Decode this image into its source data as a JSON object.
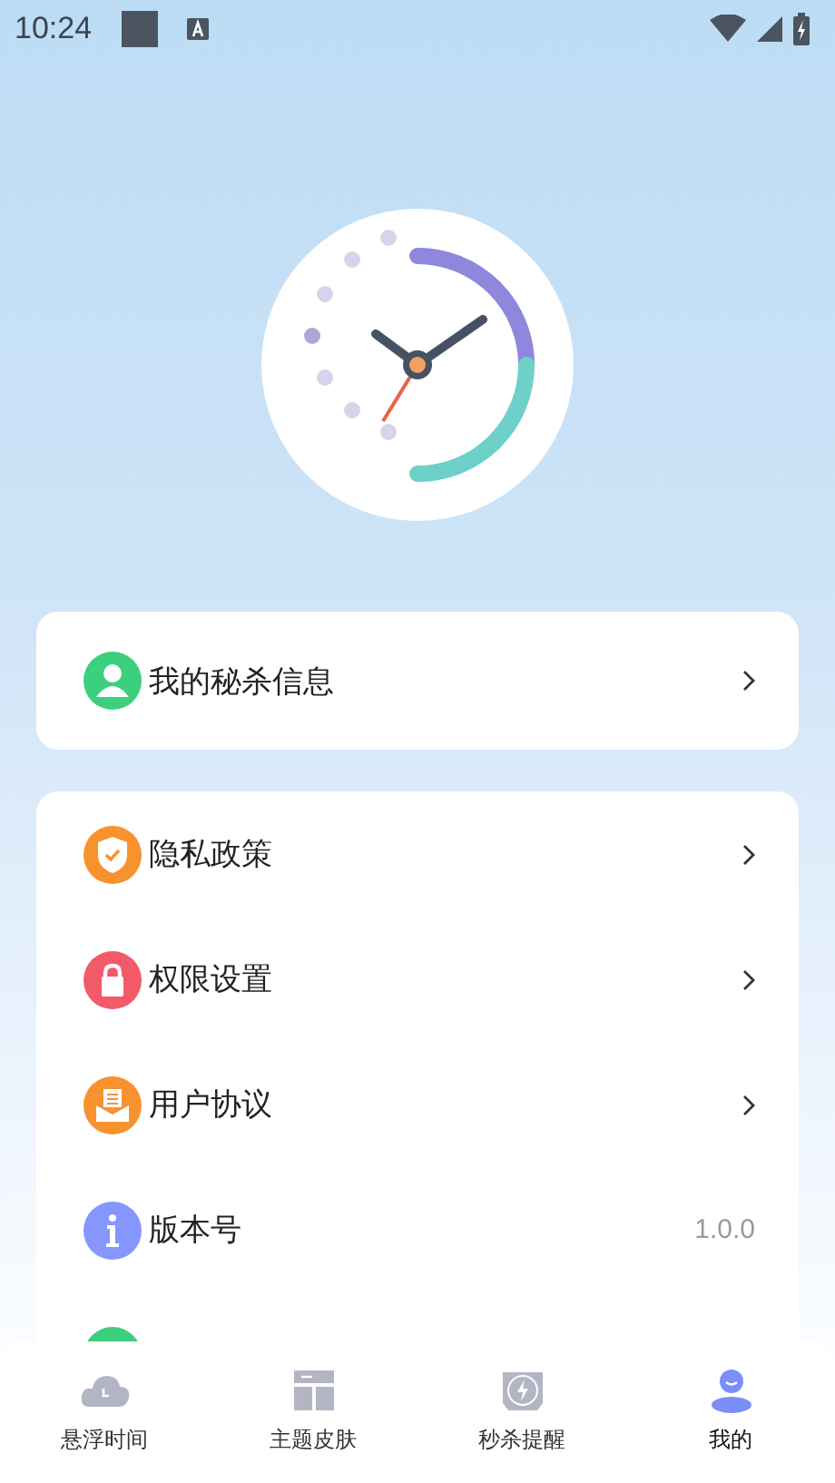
{
  "status_bar": {
    "time": "10:24"
  },
  "menu_groups": [
    {
      "items": [
        {
          "kind": "link",
          "label": "我的秘杀信息"
        }
      ]
    },
    {
      "items": [
        {
          "kind": "link",
          "label": "隐私政策"
        },
        {
          "kind": "link",
          "label": "权限设置"
        },
        {
          "kind": "link",
          "label": "用户协议"
        },
        {
          "kind": "value",
          "label": "版本号",
          "value": "1.0.0"
        },
        {
          "kind": "covered"
        }
      ]
    }
  ],
  "tabs": [
    {
      "label": "悬浮时间",
      "selected": false
    },
    {
      "label": "主题皮肤",
      "selected": false
    },
    {
      "label": "秒杀提醒",
      "selected": false
    },
    {
      "label": "我的",
      "selected": true
    }
  ]
}
